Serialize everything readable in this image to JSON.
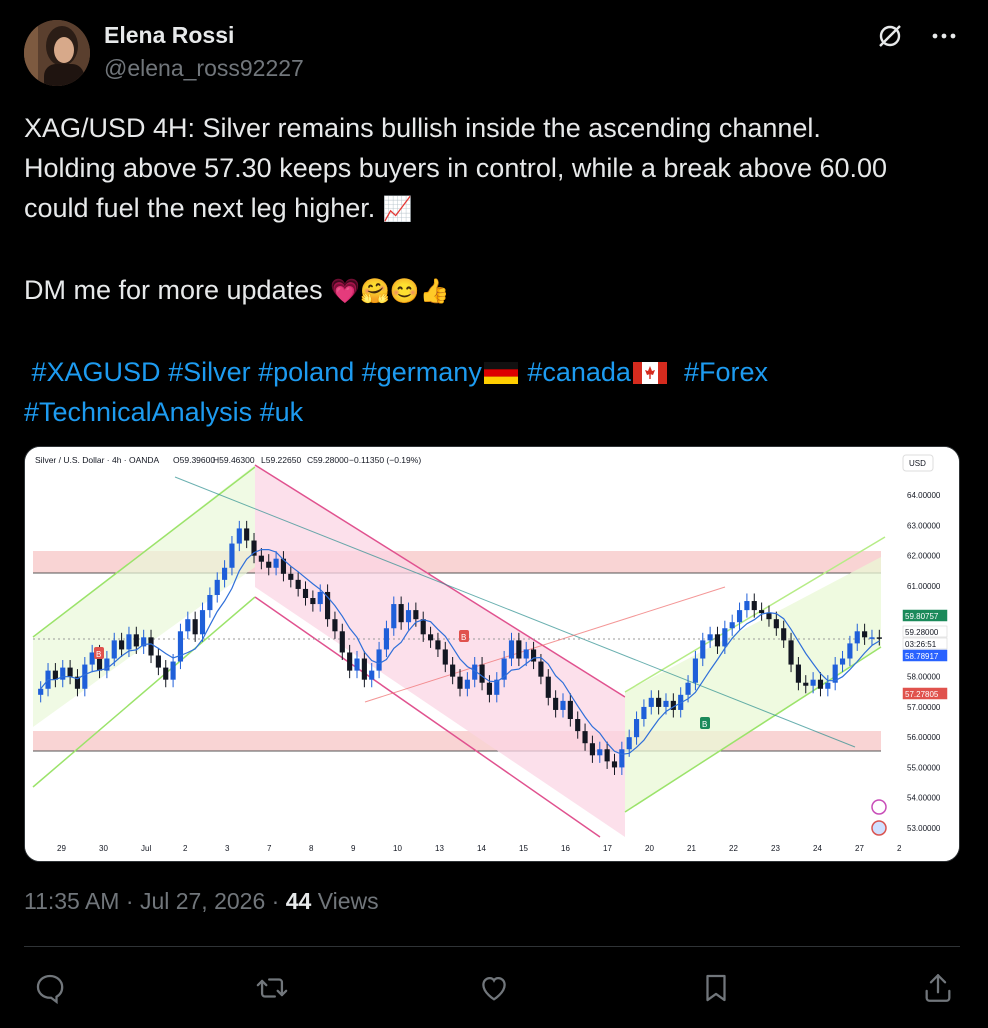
{
  "author": {
    "name": "Elena Rossi",
    "handle": "@elena_ross92227"
  },
  "tweet": {
    "line1": "XAG/USD 4H: Silver remains bullish inside the ascending channel.",
    "line2": "Holding above 57.30 keeps buyers in control, while a break above 60.00",
    "line3": "could fuel the next leg higher.",
    "emoji_chart": "📈",
    "dm_text": "DM me for more updates",
    "dm_emojis": "💗🤗😊👍",
    "tags": [
      "#XAGUSD",
      "#Silver",
      "#poland",
      "#germany",
      "#canada",
      "#Forex",
      "#TechnicalAnalysis",
      "#uk"
    ]
  },
  "meta": {
    "time": "11:35 AM",
    "date": "Jul 27, 2026",
    "sep": "·",
    "views_count": "44",
    "views_label": "Views"
  },
  "icons": {
    "grok": "slashed-circle-icon",
    "more": "more-icon",
    "reply": "reply-icon",
    "repost": "repost-icon",
    "like": "heart-icon",
    "bookmark": "bookmark-icon",
    "share": "share-icon"
  },
  "chart_data": {
    "type": "candlestick",
    "header": "Silver / U.S. Dollar · 4h · OANDA",
    "ohlc": {
      "O": "59.39600",
      "H": "59.46300",
      "L": "59.22650",
      "C": "59.28000",
      "change": "−0.11350 (−0.19%)"
    },
    "currency": "USD",
    "y_ticks": [
      "64.00000",
      "63.00000",
      "62.00000",
      "61.00000",
      "58.00000",
      "57.00000",
      "56.00000",
      "55.00000",
      "54.00000",
      "53.00000"
    ],
    "x_ticks": [
      "29",
      "30",
      "Jul",
      "2",
      "3",
      "7",
      "8",
      "9",
      "10",
      "13",
      "14",
      "15",
      "16",
      "17",
      "20",
      "21",
      "22",
      "23",
      "24",
      "27",
      "2"
    ],
    "price_labels": [
      {
        "value": "59.80757",
        "color": "#1b8a5a"
      },
      {
        "value": "59.28000",
        "color": "#ffffff"
      },
      {
        "value": "03:26:51",
        "color": "#ffffff"
      },
      {
        "value": "58.78917",
        "color": "#2962ff"
      },
      {
        "value": "57.27805",
        "color": "#e0524d"
      }
    ],
    "ylim": [
      52.7,
      64.6
    ],
    "zones": [
      {
        "name": "resistance",
        "from": 61.35,
        "to": 62.15
      },
      {
        "name": "support",
        "from": 55.5,
        "to": 56.3
      }
    ],
    "markers": [
      "B",
      "B",
      "B"
    ],
    "closes": [
      57.6,
      58.2,
      57.9,
      58.3,
      58.0,
      57.6,
      58.4,
      58.8,
      58.2,
      58.6,
      59.2,
      58.9,
      59.4,
      59.0,
      59.3,
      58.7,
      58.3,
      57.9,
      58.5,
      59.5,
      59.9,
      59.4,
      60.2,
      60.7,
      61.2,
      61.6,
      62.4,
      62.9,
      62.5,
      62.0,
      61.8,
      61.6,
      61.9,
      61.4,
      61.2,
      60.9,
      60.6,
      60.4,
      60.8,
      59.9,
      59.5,
      58.8,
      58.2,
      58.6,
      57.9,
      58.2,
      58.9,
      59.6,
      60.4,
      59.8,
      60.2,
      59.9,
      59.4,
      59.2,
      58.9,
      58.4,
      58.0,
      57.6,
      57.9,
      58.4,
      57.8,
      57.4,
      57.9,
      58.6,
      59.2,
      58.6,
      58.9,
      58.5,
      58.0,
      57.3,
      56.9,
      57.2,
      56.6,
      56.2,
      55.8,
      55.4,
      55.6,
      55.2,
      55.0,
      55.6,
      56.0,
      56.6,
      57.0,
      57.3,
      57.0,
      57.2,
      56.9,
      57.4,
      57.8,
      58.6,
      59.2,
      59.4,
      59.0,
      59.6,
      59.8,
      60.2,
      60.5,
      60.2,
      60.1,
      59.9,
      59.6,
      59.2,
      58.4,
      57.8,
      57.7,
      57.9,
      57.6,
      57.8,
      58.4,
      58.6,
      59.1,
      59.5,
      59.3,
      59.3,
      59.28
    ]
  }
}
